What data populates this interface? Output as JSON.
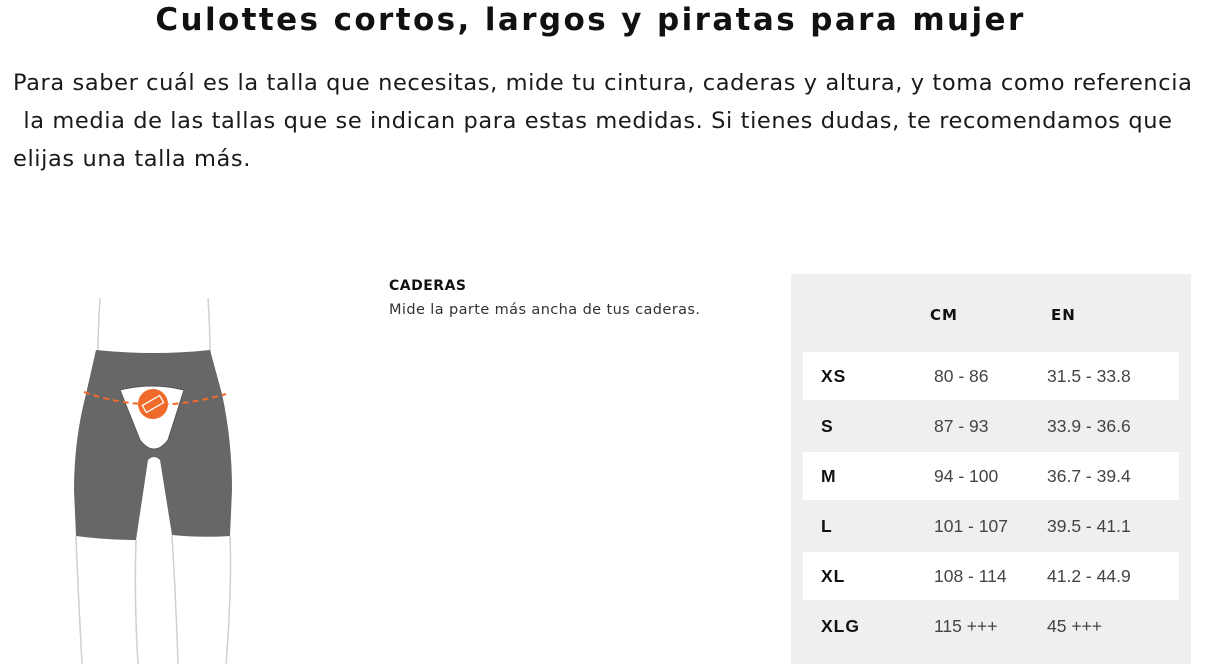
{
  "page": {
    "title": "Culottes cortos, largos y piratas para mujer",
    "intro_lines": [
      "Para saber cuál es la talla que necesitas, mide tu cintura, caderas y altura, y toma como referencia",
      "la media de las tallas que se indican para estas medidas. Si tienes dudas, te recomendamos que",
      "elijas una talla más."
    ]
  },
  "figure": {
    "icon": "ruler-icon",
    "accent_color": "#ef6a2b",
    "garment_color": "#676767"
  },
  "measure": {
    "title": "CADERAS",
    "description": "Mide la parte más ancha de tus caderas."
  },
  "size_table": {
    "headers": {
      "size": "",
      "cm": "CM",
      "en": "EN"
    },
    "rows": [
      {
        "size": "XS",
        "cm": "80 - 86",
        "en": "31.5 - 33.8"
      },
      {
        "size": "S",
        "cm": "87 - 93",
        "en": "33.9 - 36.6"
      },
      {
        "size": "M",
        "cm": "94 - 100",
        "en": "36.7 - 39.4"
      },
      {
        "size": "L",
        "cm": "101 - 107",
        "en": "39.5 - 41.1"
      },
      {
        "size": "XL",
        "cm": "108 - 114",
        "en": "41.2 - 44.9"
      },
      {
        "size": "XLG",
        "cm": "115 +++",
        "en": "45 +++"
      }
    ]
  }
}
